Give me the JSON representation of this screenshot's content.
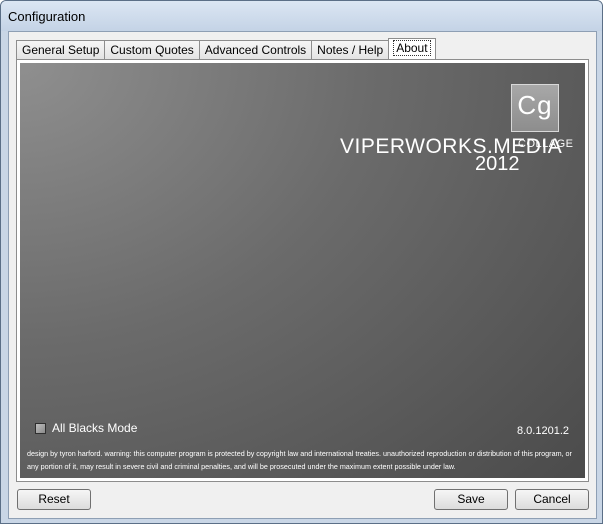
{
  "window": {
    "title": "Configuration"
  },
  "tabs": [
    {
      "label": "General Setup",
      "active": false
    },
    {
      "label": "Custom Quotes",
      "active": false
    },
    {
      "label": "Advanced Controls",
      "active": false
    },
    {
      "label": "Notes / Help",
      "active": false
    },
    {
      "label": "About",
      "active": true
    }
  ],
  "about": {
    "logo_letters": "Cg",
    "brand_name": "VIPERWORKS.MEDIA",
    "brand_product": "COLLAGE",
    "brand_year": "2012",
    "checkbox_label": "All Blacks Mode",
    "checkbox_checked": false,
    "version": "8.0.1201.2",
    "legal_text": "design by tyron harford. warning: this computer program is protected by copyright law and international treaties. unauthorized reproduction or distribution of this program, or any portion of it, may result in severe civil and criminal penalties, and will be prosecuted under the maximum extent possible under law."
  },
  "buttons": {
    "reset": "Reset",
    "save": "Save",
    "cancel": "Cancel"
  },
  "colors": {
    "frame": "#c9d6e6",
    "panel": "#f0f0f0",
    "about_bg_light": "#8f8f8f",
    "about_bg_dark": "#4a4a4a",
    "text_light": "#ffffff"
  }
}
